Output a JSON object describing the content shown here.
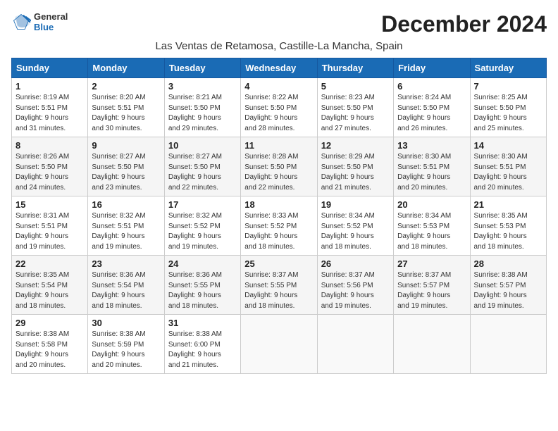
{
  "header": {
    "logo_general": "General",
    "logo_blue": "Blue",
    "month_title": "December 2024",
    "location": "Las Ventas de Retamosa, Castille-La Mancha, Spain"
  },
  "weekdays": [
    "Sunday",
    "Monday",
    "Tuesday",
    "Wednesday",
    "Thursday",
    "Friday",
    "Saturday"
  ],
  "weeks": [
    [
      {
        "day": "1",
        "info": "Sunrise: 8:19 AM\nSunset: 5:51 PM\nDaylight: 9 hours\nand 31 minutes."
      },
      {
        "day": "2",
        "info": "Sunrise: 8:20 AM\nSunset: 5:51 PM\nDaylight: 9 hours\nand 30 minutes."
      },
      {
        "day": "3",
        "info": "Sunrise: 8:21 AM\nSunset: 5:50 PM\nDaylight: 9 hours\nand 29 minutes."
      },
      {
        "day": "4",
        "info": "Sunrise: 8:22 AM\nSunset: 5:50 PM\nDaylight: 9 hours\nand 28 minutes."
      },
      {
        "day": "5",
        "info": "Sunrise: 8:23 AM\nSunset: 5:50 PM\nDaylight: 9 hours\nand 27 minutes."
      },
      {
        "day": "6",
        "info": "Sunrise: 8:24 AM\nSunset: 5:50 PM\nDaylight: 9 hours\nand 26 minutes."
      },
      {
        "day": "7",
        "info": "Sunrise: 8:25 AM\nSunset: 5:50 PM\nDaylight: 9 hours\nand 25 minutes."
      }
    ],
    [
      {
        "day": "8",
        "info": "Sunrise: 8:26 AM\nSunset: 5:50 PM\nDaylight: 9 hours\nand 24 minutes."
      },
      {
        "day": "9",
        "info": "Sunrise: 8:27 AM\nSunset: 5:50 PM\nDaylight: 9 hours\nand 23 minutes."
      },
      {
        "day": "10",
        "info": "Sunrise: 8:27 AM\nSunset: 5:50 PM\nDaylight: 9 hours\nand 22 minutes."
      },
      {
        "day": "11",
        "info": "Sunrise: 8:28 AM\nSunset: 5:50 PM\nDaylight: 9 hours\nand 22 minutes."
      },
      {
        "day": "12",
        "info": "Sunrise: 8:29 AM\nSunset: 5:50 PM\nDaylight: 9 hours\nand 21 minutes."
      },
      {
        "day": "13",
        "info": "Sunrise: 8:30 AM\nSunset: 5:51 PM\nDaylight: 9 hours\nand 20 minutes."
      },
      {
        "day": "14",
        "info": "Sunrise: 8:30 AM\nSunset: 5:51 PM\nDaylight: 9 hours\nand 20 minutes."
      }
    ],
    [
      {
        "day": "15",
        "info": "Sunrise: 8:31 AM\nSunset: 5:51 PM\nDaylight: 9 hours\nand 19 minutes."
      },
      {
        "day": "16",
        "info": "Sunrise: 8:32 AM\nSunset: 5:51 PM\nDaylight: 9 hours\nand 19 minutes."
      },
      {
        "day": "17",
        "info": "Sunrise: 8:32 AM\nSunset: 5:52 PM\nDaylight: 9 hours\nand 19 minutes."
      },
      {
        "day": "18",
        "info": "Sunrise: 8:33 AM\nSunset: 5:52 PM\nDaylight: 9 hours\nand 18 minutes."
      },
      {
        "day": "19",
        "info": "Sunrise: 8:34 AM\nSunset: 5:52 PM\nDaylight: 9 hours\nand 18 minutes."
      },
      {
        "day": "20",
        "info": "Sunrise: 8:34 AM\nSunset: 5:53 PM\nDaylight: 9 hours\nand 18 minutes."
      },
      {
        "day": "21",
        "info": "Sunrise: 8:35 AM\nSunset: 5:53 PM\nDaylight: 9 hours\nand 18 minutes."
      }
    ],
    [
      {
        "day": "22",
        "info": "Sunrise: 8:35 AM\nSunset: 5:54 PM\nDaylight: 9 hours\nand 18 minutes."
      },
      {
        "day": "23",
        "info": "Sunrise: 8:36 AM\nSunset: 5:54 PM\nDaylight: 9 hours\nand 18 minutes."
      },
      {
        "day": "24",
        "info": "Sunrise: 8:36 AM\nSunset: 5:55 PM\nDaylight: 9 hours\nand 18 minutes."
      },
      {
        "day": "25",
        "info": "Sunrise: 8:37 AM\nSunset: 5:55 PM\nDaylight: 9 hours\nand 18 minutes."
      },
      {
        "day": "26",
        "info": "Sunrise: 8:37 AM\nSunset: 5:56 PM\nDaylight: 9 hours\nand 19 minutes."
      },
      {
        "day": "27",
        "info": "Sunrise: 8:37 AM\nSunset: 5:57 PM\nDaylight: 9 hours\nand 19 minutes."
      },
      {
        "day": "28",
        "info": "Sunrise: 8:38 AM\nSunset: 5:57 PM\nDaylight: 9 hours\nand 19 minutes."
      }
    ],
    [
      {
        "day": "29",
        "info": "Sunrise: 8:38 AM\nSunset: 5:58 PM\nDaylight: 9 hours\nand 20 minutes."
      },
      {
        "day": "30",
        "info": "Sunrise: 8:38 AM\nSunset: 5:59 PM\nDaylight: 9 hours\nand 20 minutes."
      },
      {
        "day": "31",
        "info": "Sunrise: 8:38 AM\nSunset: 6:00 PM\nDaylight: 9 hours\nand 21 minutes."
      },
      null,
      null,
      null,
      null
    ]
  ]
}
